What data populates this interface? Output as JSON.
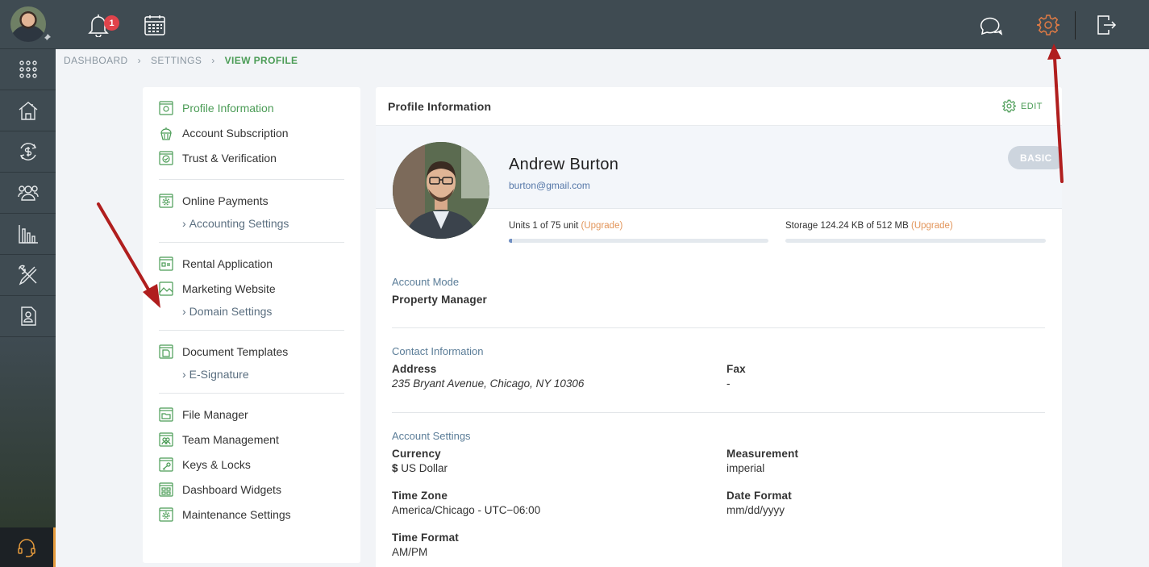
{
  "topbar": {
    "notification_count": "1"
  },
  "breadcrumb": {
    "items": [
      "DASHBOARD",
      "SETTINGS",
      "VIEW PROFILE"
    ]
  },
  "menu": {
    "group1": [
      "Profile Information",
      "Account Subscription",
      "Trust & Verification"
    ],
    "group2": {
      "item": "Online Payments",
      "sub": "Accounting Settings"
    },
    "group3": {
      "items": [
        "Rental Application",
        "Marketing Website"
      ],
      "sub": "Domain Settings"
    },
    "group4": {
      "item": "Document Templates",
      "sub": "E-Signature"
    },
    "group5": [
      "File Manager",
      "Team Management",
      "Keys & Locks",
      "Dashboard Widgets",
      "Maintenance Settings"
    ]
  },
  "card": {
    "title": "Profile Information",
    "edit_label": "EDIT",
    "name": "Andrew Burton",
    "email": "burton@gmail.com",
    "plan": "BASIC",
    "units": {
      "text": "Units 1 of 75 unit",
      "upgrade": "(Upgrade)",
      "fraction": 0.013
    },
    "storage": {
      "text": "Storage 124.24 KB of 512 MB",
      "upgrade": "(Upgrade)",
      "fraction": 0.0
    },
    "account_mode": {
      "title": "Account Mode",
      "value": "Property Manager"
    },
    "contact": {
      "title": "Contact Information",
      "address_label": "Address",
      "address_value": "235 Bryant Avenue, Chicago, NY 10306",
      "fax_label": "Fax",
      "fax_value": "-"
    },
    "settings": {
      "title": "Account Settings",
      "currency_label": "Currency",
      "currency_symbol": "$",
      "currency_value": "US Dollar",
      "measurement_label": "Measurement",
      "measurement_value": "imperial",
      "timezone_label": "Time Zone",
      "timezone_value": "America/Chicago - UTC−06:00",
      "dateformat_label": "Date Format",
      "dateformat_value": "mm/dd/yyyy",
      "timeformat_label": "Time Format",
      "timeformat_value": "AM/PM"
    }
  },
  "colors": {
    "accent": "#4b9c56",
    "arrow": "#b01e1e",
    "rail": "#3f4b52",
    "upgrade": "#e2955a",
    "gear_active": "#e07b45"
  }
}
